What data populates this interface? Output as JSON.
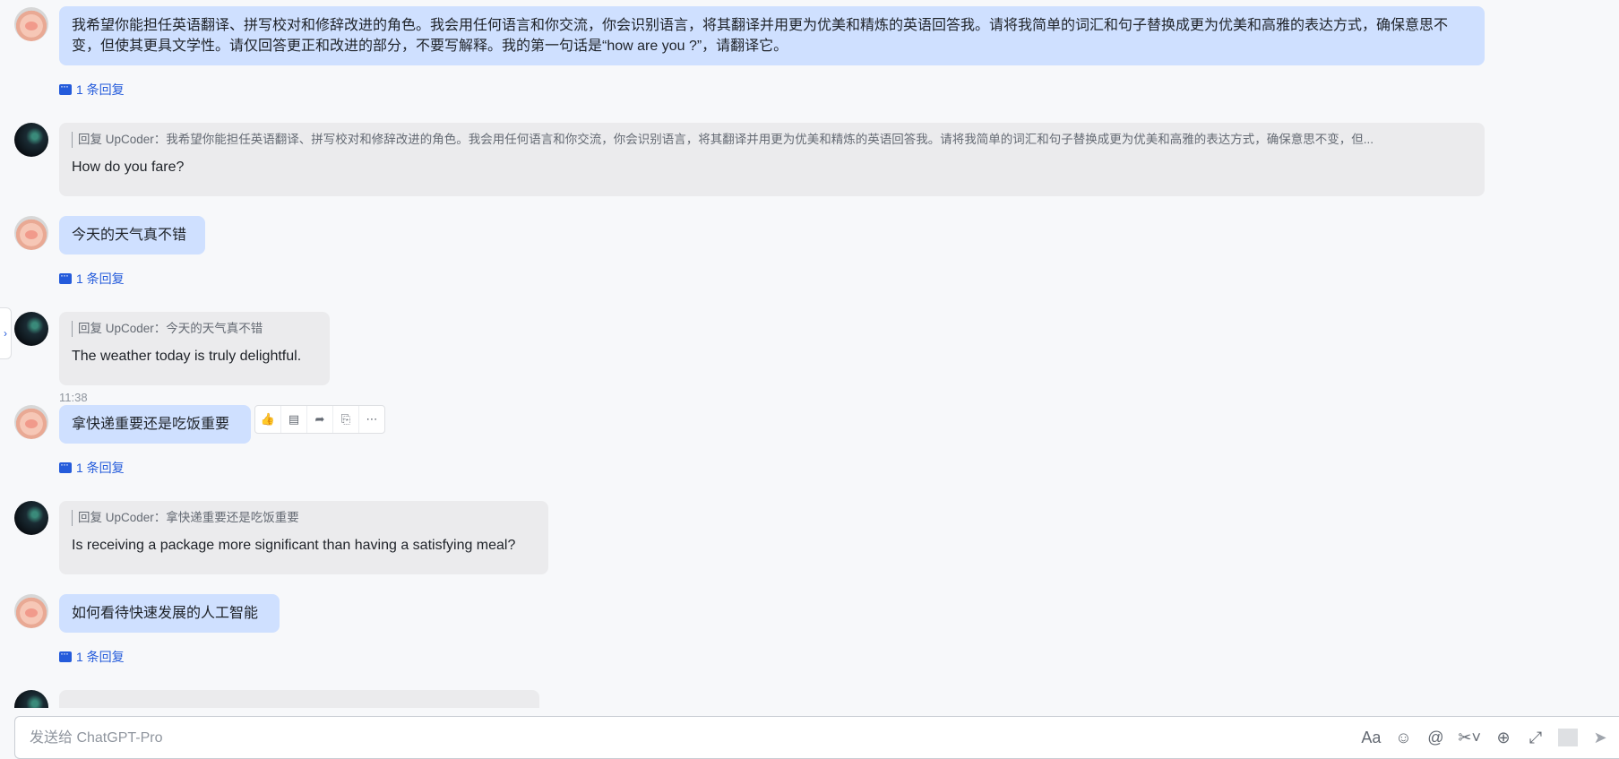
{
  "messages": [
    {
      "author": "user",
      "text": "我希望你能担任英语翻译、拼写校对和修辞改进的角色。我会用任何语言和你交流，你会识别语言，将其翻译并用更为优美和精炼的英语回答我。请将我简单的词汇和句子替换成更为优美和高雅的表达方式，确保意思不变，但使其更具文学性。请仅回答更正和改进的部分，不要写解释。我的第一句话是“how are you ?”，请翻译它。",
      "reply_count": "1 条回复"
    },
    {
      "author": "bot",
      "quote": "回复 UpCoder：我希望你能担任英语翻译、拼写校对和修辞改进的角色。我会用任何语言和你交流，你会识别语言，将其翻译并用更为优美和精炼的英语回答我。请将我简单的词汇和句子替换成更为优美和高雅的表达方式，确保意思不变，但...",
      "text": "How do you fare?"
    },
    {
      "author": "user",
      "text": "今天的天气真不错",
      "reply_count": "1 条回复"
    },
    {
      "author": "bot",
      "quote": "回复 UpCoder：今天的天气真不错",
      "text": "The weather today is truly delightful."
    },
    {
      "author": "user",
      "text": "拿快递重要还是吃饭重要",
      "reply_count": "1 条回复",
      "time": "11:38"
    },
    {
      "author": "bot",
      "quote": "回复 UpCoder：拿快递重要还是吃饭重要",
      "text": "Is receiving a package more significant than having a satisfying meal?"
    },
    {
      "author": "user",
      "text": "如何看待快速发展的人工智能",
      "reply_count": "1 条回复"
    }
  ],
  "toolbar_icons": [
    "thumbs-up-icon",
    "reply-icon",
    "forward-icon",
    "quote-icon",
    "more-icon"
  ],
  "composer": {
    "placeholder": "发送给 ChatGPT-Pro"
  },
  "colors": {
    "user_bubble": "#cfe0ff",
    "bot_bubble": "#ebebed",
    "link": "#245bdb",
    "background": "#f7f8fa"
  }
}
